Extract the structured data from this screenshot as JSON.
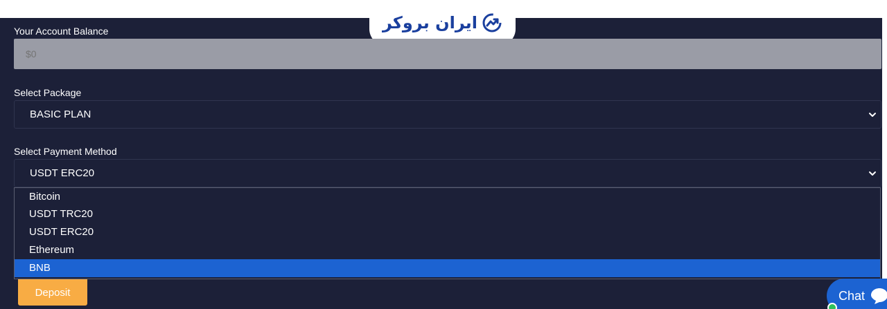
{
  "brand": {
    "logo_text": "ایران بروکر",
    "color": "#1a3f9e"
  },
  "balance": {
    "label": "Your Account Balance",
    "placeholder": "$0"
  },
  "package": {
    "label": "Select Package",
    "selected": "BASIC PLAN"
  },
  "payment": {
    "label": "Select Payment Method",
    "selected": "USDT ERC20",
    "options": [
      "Bitcoin",
      "USDT TRC20",
      "USDT ERC20",
      "Ethereum",
      "BNB"
    ],
    "highlighted": "BNB"
  },
  "deposit": {
    "label": "Deposit",
    "color": "#f8ac44"
  },
  "chat": {
    "label": "Chat",
    "color": "#1c63d2",
    "status_color": "#2ec25c"
  },
  "icons": {
    "logo": "trend-arrow-icon",
    "select_chevron": "chevron-down-icon",
    "chat": "chat-bubble-icon"
  }
}
